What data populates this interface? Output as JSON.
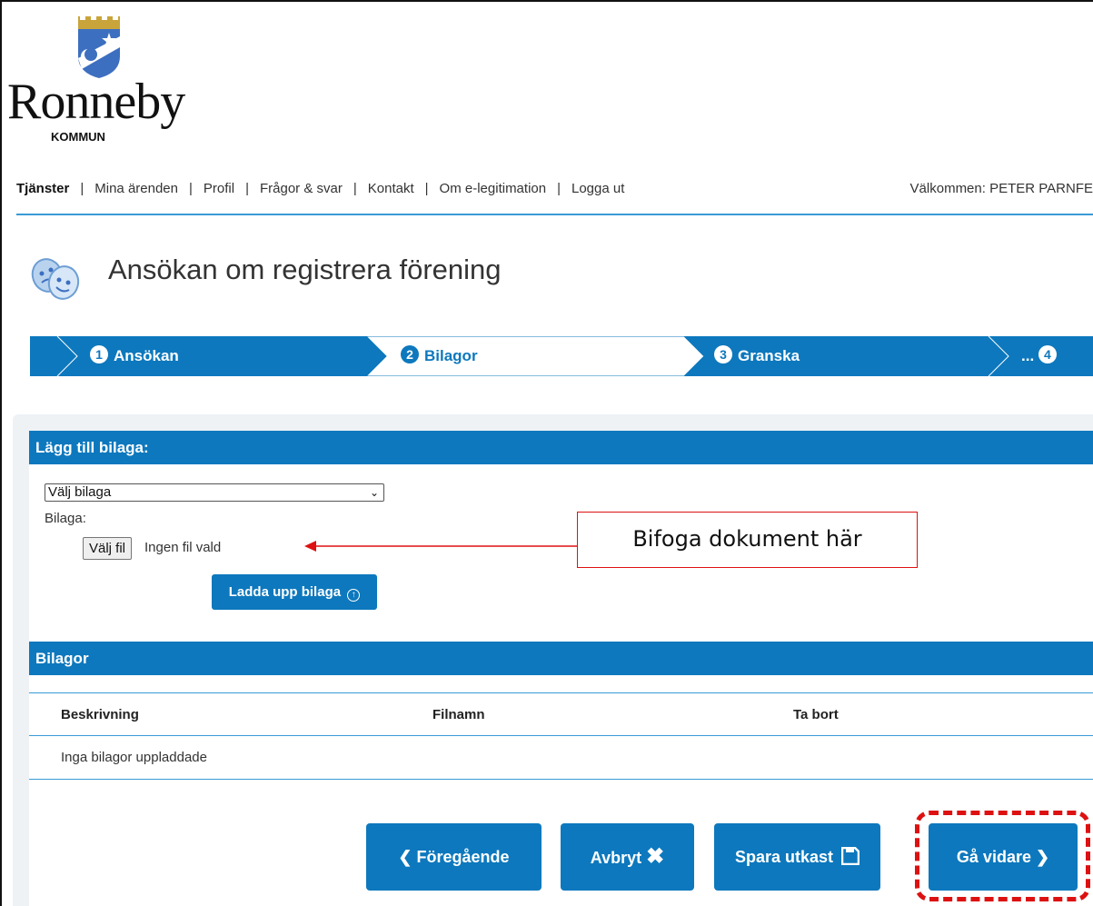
{
  "logo": {
    "name": "Ronneby",
    "subtitle": "KOMMUN"
  },
  "nav": {
    "items": [
      {
        "label": "Tjänster",
        "active": true
      },
      {
        "label": "Mina ärenden"
      },
      {
        "label": "Profil"
      },
      {
        "label": "Frågor & svar"
      },
      {
        "label": "Kontakt"
      },
      {
        "label": "Om e-legitimation"
      },
      {
        "label": "Logga ut"
      }
    ],
    "separator": "|",
    "welcome": "Välkommen: PETER PARNFE"
  },
  "page": {
    "title": "Ansökan om registrera förening",
    "icon": "theater-masks-icon"
  },
  "steps": [
    {
      "num": "1",
      "label": "Ansökan"
    },
    {
      "num": "2",
      "label": "Bilagor",
      "current": true
    },
    {
      "num": "3",
      "label": "Granska"
    },
    {
      "num": "4",
      "label": "..."
    }
  ],
  "add_attachment": {
    "heading": "Lägg till bilaga:",
    "select_value": "Välj bilaga",
    "file_label": "Bilaga:",
    "file_button": "Välj fil",
    "file_status": "Ingen fil vald",
    "upload_button": "Ladda upp bilaga"
  },
  "callout": {
    "text": "Bifoga dokument här",
    "color": "#dd1111"
  },
  "attachments": {
    "heading": "Bilagor",
    "columns": [
      "Beskrivning",
      "Filnamn",
      "Ta bort"
    ],
    "empty_text": "Inga bilagor uppladdade"
  },
  "footer": {
    "prev": "Föregående",
    "cancel": "Avbryt",
    "save_draft": "Spara utkast",
    "next": "Gå vidare"
  },
  "colors": {
    "primary": "#0d78bd",
    "accent_line": "#3a9ad6",
    "panel_bg": "#eef2f5"
  }
}
